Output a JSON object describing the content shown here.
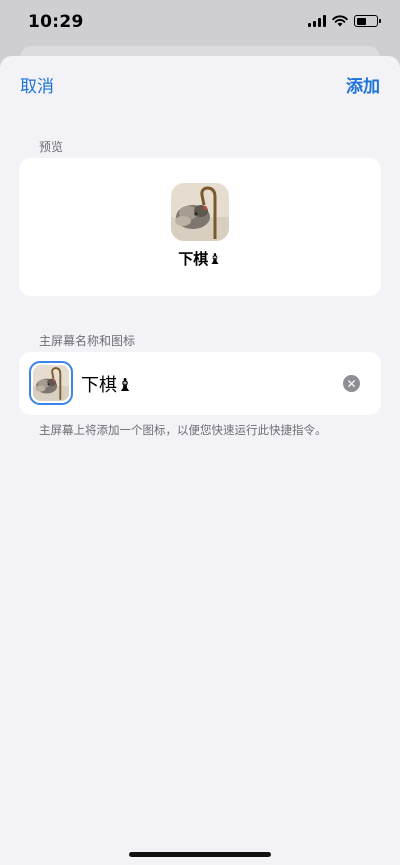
{
  "status_bar": {
    "time": "10:29",
    "battery_level": 0.55
  },
  "nav": {
    "cancel_label": "取消",
    "add_label": "添加"
  },
  "preview": {
    "section_title": "预览",
    "shortcut_name": "下棋♝"
  },
  "home_screen": {
    "section_title": "主屏幕名称和图标",
    "name_value": "下棋♝",
    "clear_icon": "clear-icon",
    "footer": "主屏幕上将添加一个图标，以便您快速运行此快捷指令。"
  },
  "colors": {
    "accent": "#1e73d8",
    "sheet_bg": "#f2f2f7",
    "secondary_text": "#6d6d72"
  }
}
